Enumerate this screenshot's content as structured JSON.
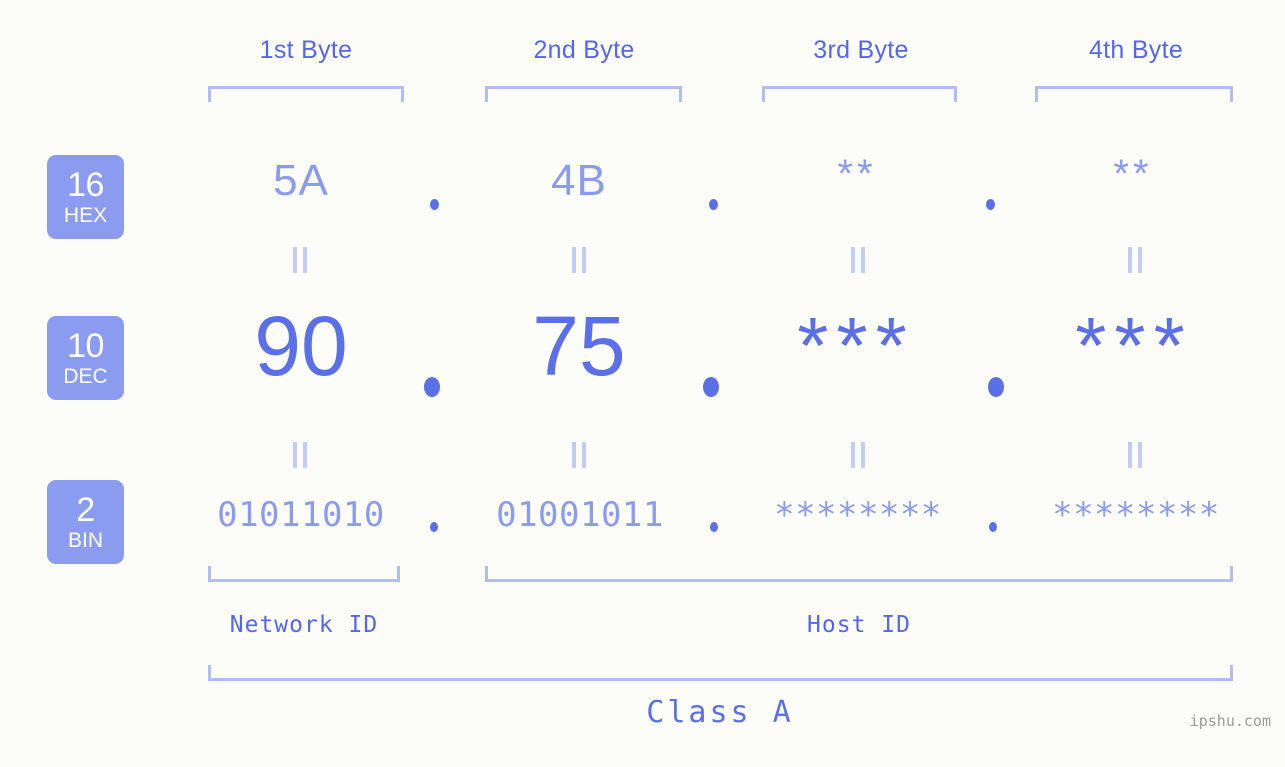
{
  "background_color": "#fcfdf8",
  "accent_color": "#5a6fe8",
  "light_accent_color": "#8b9bf0",
  "bracket_color": "#b3bdf5",
  "byte_headers": [
    {
      "label": "1st Byte"
    },
    {
      "label": "2nd Byte"
    },
    {
      "label": "3rd Byte"
    },
    {
      "label": "4th Byte"
    }
  ],
  "radix_badges": [
    {
      "number": "16",
      "system": "HEX"
    },
    {
      "number": "10",
      "system": "DEC"
    },
    {
      "number": "2",
      "system": "BIN"
    }
  ],
  "separator": ".",
  "rows": {
    "hex": {
      "radix": "16",
      "system": "HEX",
      "values": [
        "5A",
        "4B",
        "**",
        "**"
      ]
    },
    "dec": {
      "radix": "10",
      "system": "DEC",
      "values": [
        "90",
        "75",
        "***",
        "***"
      ]
    },
    "bin": {
      "radix": "2",
      "system": "BIN",
      "values": [
        "01011010",
        "01001011",
        "********",
        "********"
      ]
    }
  },
  "id_sections": [
    {
      "label": "Network ID"
    },
    {
      "label": "Host ID"
    }
  ],
  "class_label": "Class A",
  "watermark": "ipshu.com"
}
